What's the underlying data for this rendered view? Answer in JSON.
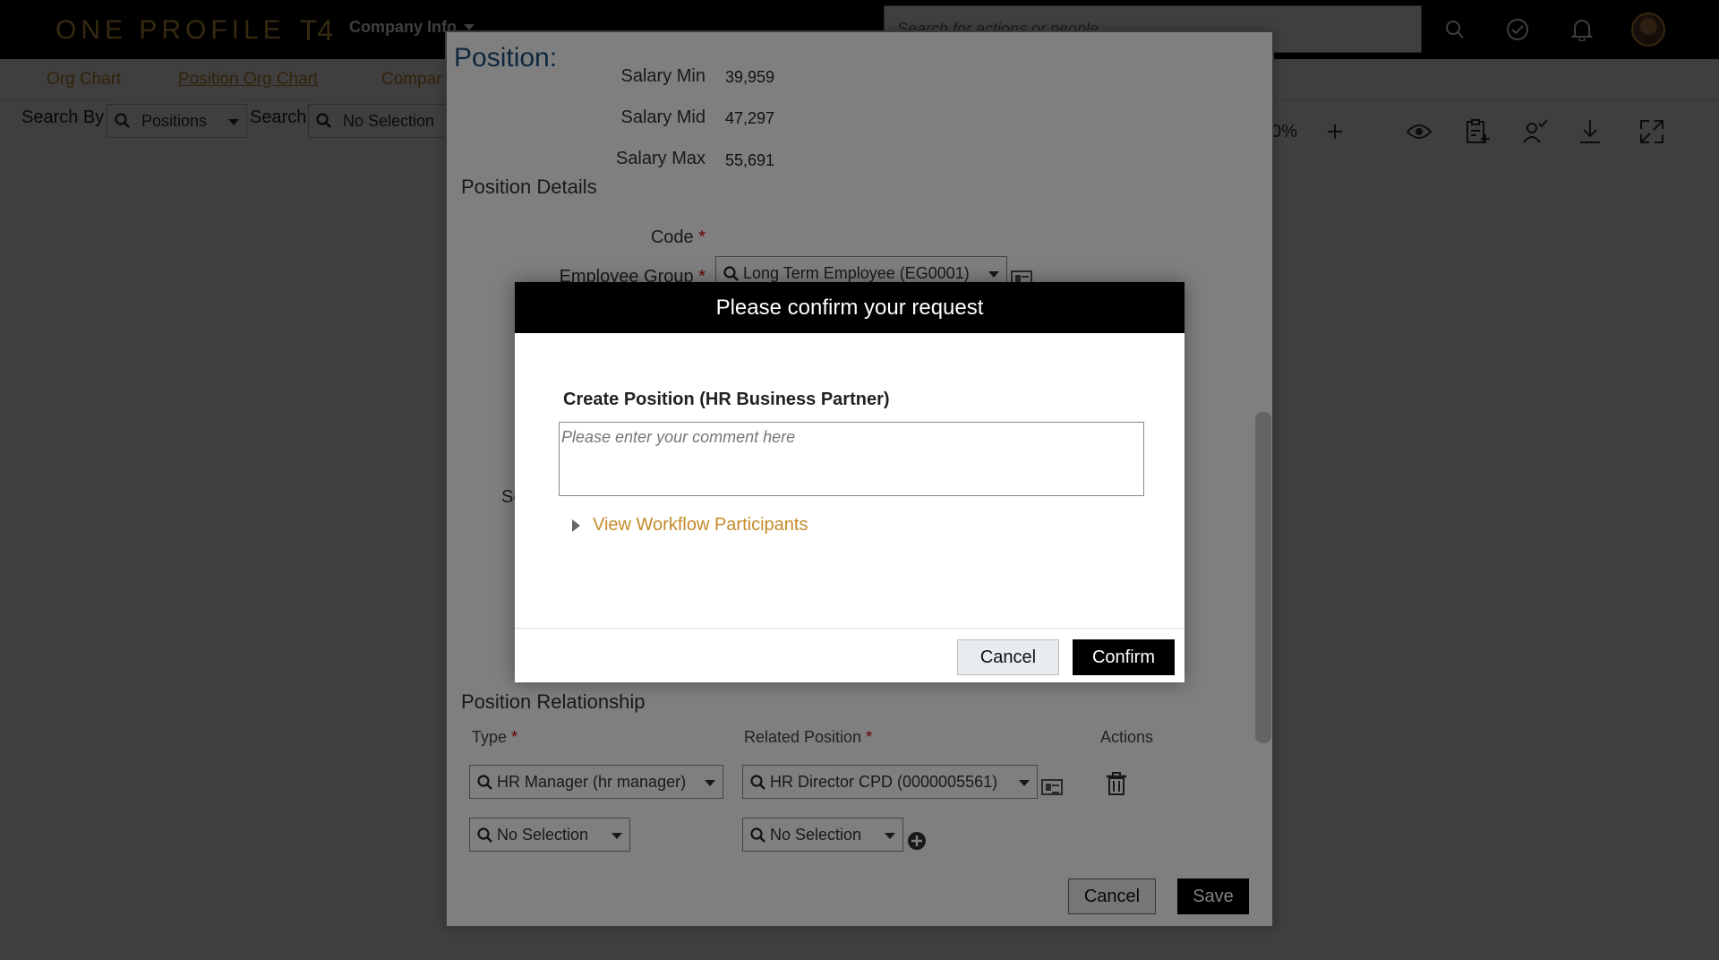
{
  "shell": {
    "logo_text": "ONE PROFILE",
    "logo_suffix": "T4",
    "company_menu": "Company Info",
    "search_placeholder": "Search for actions or people"
  },
  "subnav": {
    "tabs": [
      {
        "label": "Org Chart"
      },
      {
        "label": "Position Org Chart"
      },
      {
        "label": "Compar"
      }
    ]
  },
  "search_row": {
    "search_by_label": "Search By",
    "search_by_value": "Positions",
    "search_label": "Search",
    "search_value": "No Selection",
    "zoom": "0%"
  },
  "position_dialog": {
    "title": "Position:",
    "salary_min_label": "Salary Min",
    "salary_min_value": "39,959",
    "salary_mid_label": "Salary Mid",
    "salary_mid_value": "47,297",
    "salary_max_label": "Salary Max",
    "salary_max_value": "55,691",
    "details_title": "Position Details",
    "code_label": "Code",
    "employee_group_label": "Employee Group",
    "employee_group_value": "Long Term Employee (EG0001)",
    "partial_label": "Se",
    "relationship_title": "Position Relationship",
    "col_type": "Type",
    "col_related": "Related Position",
    "col_actions": "Actions",
    "rows": [
      {
        "type": "HR Manager (hr manager)",
        "related": "HR Director CPD (0000005561)"
      },
      {
        "type": "No Selection",
        "related": "No Selection"
      }
    ],
    "cancel_label": "Cancel",
    "save_label": "Save"
  },
  "confirm_dialog": {
    "title": "Please confirm your request",
    "subtitle": "Create Position (HR Business Partner)",
    "comment_placeholder": "Please enter your comment here",
    "workflow_link": "View Workflow Participants",
    "cancel_label": "Cancel",
    "confirm_label": "Confirm"
  },
  "colors": {
    "brand_gold": "#c58a2a",
    "title_blue": "#1f4e7a",
    "header_black": "#000000"
  },
  "icons": [
    "search-icon",
    "check-circle-icon",
    "bell-icon",
    "eye-icon",
    "clipboard-add-icon",
    "user-check-icon",
    "download-icon",
    "expand-icon",
    "trash-icon",
    "plus-circle-icon",
    "business-card-icon"
  ]
}
